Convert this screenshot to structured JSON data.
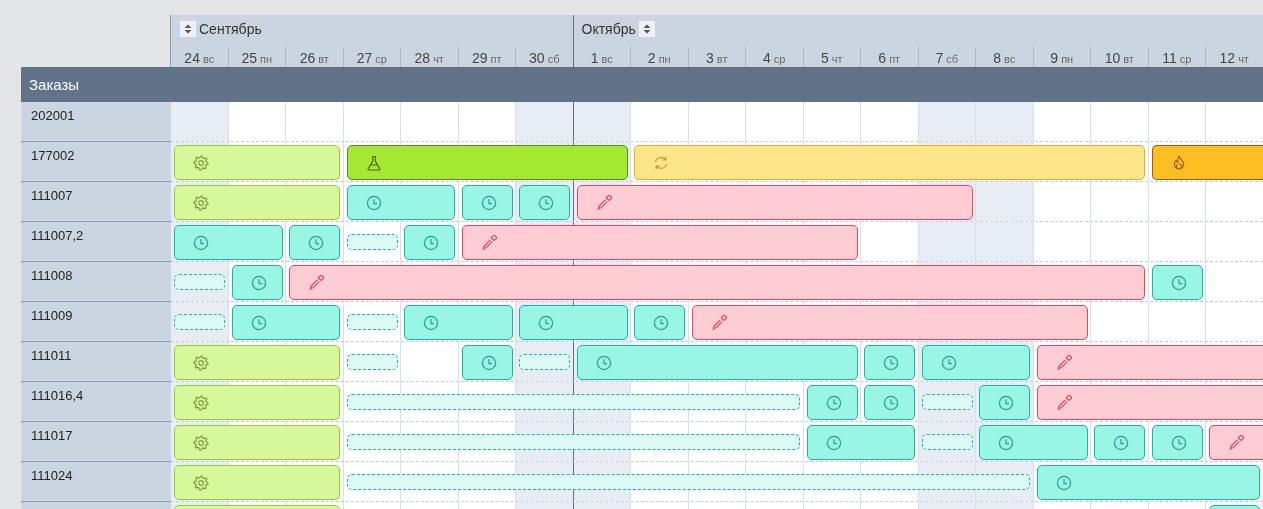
{
  "timeline": {
    "months": [
      {
        "label": "Сентябрь",
        "icon_first": true,
        "days": [
          {
            "day": "24",
            "weekday": "вс",
            "weekend": true
          },
          {
            "day": "25",
            "weekday": "пн",
            "weekend": false
          },
          {
            "day": "26",
            "weekday": "вт",
            "weekend": false
          },
          {
            "day": "27",
            "weekday": "ср",
            "weekend": false
          },
          {
            "day": "28",
            "weekday": "чт",
            "weekend": false
          },
          {
            "day": "29",
            "weekday": "пт",
            "weekend": false
          },
          {
            "day": "30",
            "weekday": "сб",
            "weekend": true
          }
        ]
      },
      {
        "label": "Октябрь",
        "icon_first": false,
        "days": [
          {
            "day": "1",
            "weekday": "вс",
            "weekend": true
          },
          {
            "day": "2",
            "weekday": "пн",
            "weekend": false
          },
          {
            "day": "3",
            "weekday": "вт",
            "weekend": false
          },
          {
            "day": "4",
            "weekday": "ср",
            "weekend": false
          },
          {
            "day": "5",
            "weekday": "чт",
            "weekend": false
          },
          {
            "day": "6",
            "weekday": "пт",
            "weekend": false
          },
          {
            "day": "7",
            "weekday": "сб",
            "weekend": true
          },
          {
            "day": "8",
            "weekday": "вс",
            "weekend": true
          },
          {
            "day": "9",
            "weekday": "пн",
            "weekend": false
          },
          {
            "day": "10",
            "weekday": "вт",
            "weekend": false
          },
          {
            "day": "11",
            "weekday": "ср",
            "weekend": false
          },
          {
            "day": "12",
            "weekday": "чт",
            "weekend": false
          }
        ]
      }
    ]
  },
  "orders": {
    "title": "Заказы",
    "rows": [
      {
        "order": "202001"
      },
      {
        "order": "177002",
        "bars": [
          {
            "kind": "setup"
          },
          {
            "kind": "lab"
          },
          {
            "kind": "cycle"
          },
          {
            "kind": "fire"
          }
        ]
      },
      {
        "order": "111007",
        "bars": [
          {
            "kind": "setup"
          },
          {
            "kind": "wait"
          },
          {
            "kind": "wait"
          },
          {
            "kind": "wait"
          },
          {
            "kind": "paint"
          }
        ]
      },
      {
        "order": "111007,2",
        "bars": [
          {
            "kind": "wait"
          },
          {
            "kind": "wait"
          },
          {
            "kind": "pending"
          },
          {
            "kind": "wait"
          },
          {
            "kind": "paint"
          }
        ]
      },
      {
        "order": "111008",
        "bars": [
          {
            "kind": "pending"
          },
          {
            "kind": "wait"
          },
          {
            "kind": "paint"
          },
          {
            "kind": "wait"
          }
        ]
      },
      {
        "order": "111009",
        "bars": [
          {
            "kind": "pending"
          },
          {
            "kind": "wait"
          },
          {
            "kind": "pending"
          },
          {
            "kind": "wait"
          },
          {
            "kind": "wait"
          },
          {
            "kind": "wait"
          },
          {
            "kind": "paint"
          }
        ]
      },
      {
        "order": "111011",
        "bars": [
          {
            "kind": "setup"
          },
          {
            "kind": "pending"
          },
          {
            "kind": "wait"
          },
          {
            "kind": "pending"
          },
          {
            "kind": "wait"
          },
          {
            "kind": "wait"
          },
          {
            "kind": "wait"
          },
          {
            "kind": "paint"
          }
        ]
      },
      {
        "order": "111016,4",
        "bars": [
          {
            "kind": "setup"
          },
          {
            "kind": "pending"
          },
          {
            "kind": "wait"
          },
          {
            "kind": "wait"
          },
          {
            "kind": "pending"
          },
          {
            "kind": "wait"
          },
          {
            "kind": "paint"
          }
        ]
      },
      {
        "order": "111017",
        "bars": [
          {
            "kind": "setup"
          },
          {
            "kind": "pending"
          },
          {
            "kind": "wait"
          },
          {
            "kind": "pending"
          },
          {
            "kind": "wait"
          },
          {
            "kind": "wait"
          },
          {
            "kind": "wait"
          },
          {
            "kind": "paint"
          }
        ]
      },
      {
        "order": "111024",
        "bars": [
          {
            "kind": "setup"
          },
          {
            "kind": "pending"
          },
          {
            "kind": "wait"
          }
        ]
      },
      {
        "bars": [
          {
            "kind": "setup"
          },
          {
            "kind": "wait"
          }
        ]
      }
    ]
  }
}
